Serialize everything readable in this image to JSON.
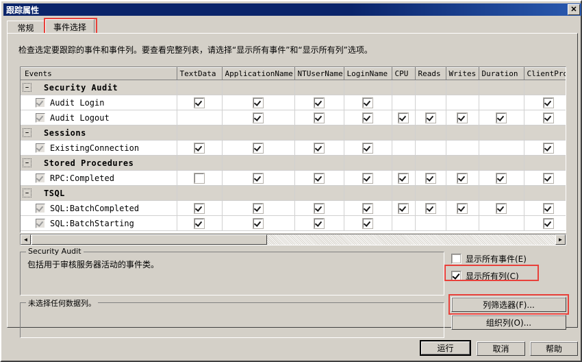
{
  "window": {
    "title": "跟踪属性",
    "close_label": "✕"
  },
  "tabs": [
    {
      "label": "常规",
      "active": false
    },
    {
      "label": "事件选择",
      "active": true
    }
  ],
  "instruction": "检查选定要跟踪的事件和事件列。要查看完整列表，请选择“显示所有事件”和“显示所有列”选项。",
  "grid": {
    "columns": [
      "Events",
      "TextData",
      "ApplicationName",
      "NTUserName",
      "LoginName",
      "CPU",
      "Reads",
      "Writes",
      "Duration",
      "ClientProc"
    ],
    "expander_glyph": "–",
    "rows": [
      {
        "type": "group",
        "label": "Security Audit"
      },
      {
        "type": "event",
        "label": "Audit Login",
        "enabled": true,
        "cells": [
          true,
          true,
          true,
          true,
          false,
          false,
          false,
          false,
          true
        ]
      },
      {
        "type": "event",
        "label": "Audit Logout",
        "enabled": true,
        "cells": [
          false,
          true,
          true,
          true,
          true,
          true,
          true,
          true,
          true
        ]
      },
      {
        "type": "group",
        "label": "Sessions"
      },
      {
        "type": "event",
        "label": "ExistingConnection",
        "enabled": true,
        "cells": [
          true,
          true,
          true,
          true,
          false,
          false,
          false,
          false,
          true
        ]
      },
      {
        "type": "group",
        "label": "Stored Procedures"
      },
      {
        "type": "event",
        "label": "RPC:Completed",
        "enabled": true,
        "cells": [
          false,
          true,
          true,
          true,
          true,
          true,
          true,
          true,
          true
        ],
        "textdata_empty_box": true
      },
      {
        "type": "group",
        "label": "TSQL"
      },
      {
        "type": "event",
        "label": "SQL:BatchCompleted",
        "enabled": true,
        "cells": [
          true,
          true,
          true,
          true,
          true,
          true,
          true,
          true,
          true
        ]
      },
      {
        "type": "event",
        "label": "SQL:BatchStarting",
        "enabled": true,
        "cells": [
          true,
          true,
          true,
          true,
          false,
          false,
          false,
          false,
          true
        ]
      }
    ]
  },
  "scrollbar": {
    "left_arrow": "◄",
    "right_arrow": "►"
  },
  "description_group": {
    "legend": "Security Audit",
    "text": "包括用于审核服务器活动的事件类。"
  },
  "columns_group": {
    "legend": "未选择任何数据列。",
    "text": ""
  },
  "options": {
    "show_all_events": {
      "label": "显示所有事件(E)",
      "checked": false
    },
    "show_all_columns": {
      "label": "显示所有列(C)",
      "checked": true
    }
  },
  "side_buttons": {
    "column_filters": "列筛选器(F)...",
    "organize_columns": "组织列(O)..."
  },
  "footer_buttons": {
    "run": "运行",
    "cancel": "取消",
    "help": "帮助"
  },
  "highlight_color": "#e8403a"
}
